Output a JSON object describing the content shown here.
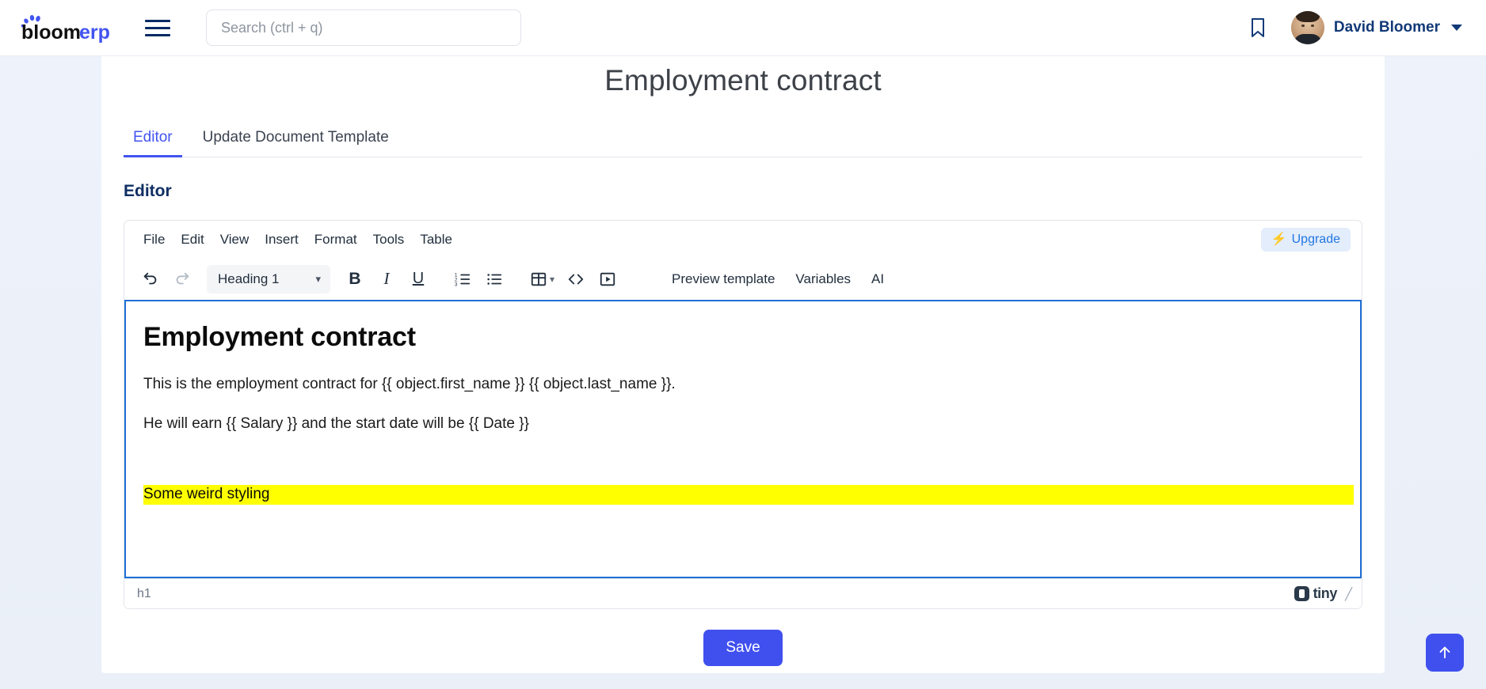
{
  "header": {
    "logo_text_primary": "bloom",
    "logo_text_accent": "erp",
    "menu_icon": "hamburger-icon",
    "search": {
      "placeholder": "Search (ctrl + q)",
      "value": ""
    },
    "bookmark_icon": "bookmark-icon",
    "user": {
      "name": "David Bloomer",
      "avatar": "user-avatar-photo",
      "caret_icon": "chevron-down-icon"
    },
    "colors": {
      "accent": "#4254f0",
      "navy": "#052a64"
    }
  },
  "page": {
    "title": "Employment contract",
    "tabs": [
      {
        "label": "Editor",
        "active": true
      },
      {
        "label": "Update Document Template",
        "active": false
      }
    ],
    "section_title": "Editor"
  },
  "editor": {
    "menubar": [
      "File",
      "Edit",
      "View",
      "Insert",
      "Format",
      "Tools",
      "Table"
    ],
    "upgrade": {
      "label": "Upgrade",
      "icon": "lightning-bolt-icon",
      "icon_color": "#ff6f1e",
      "text_color": "#2276e0"
    },
    "toolbar": {
      "undo_icon": "undo-arrow-icon",
      "redo_icon": "redo-arrow-icon",
      "format_select_value": "Heading 1",
      "bold_label": "B",
      "italic_label": "I",
      "underline_label": "U",
      "numbered_list_icon": "numbered-list-icon",
      "bullet_list_icon": "bullet-list-icon",
      "table_icon": "table-icon",
      "source_code_icon": "source-code-icon",
      "media_icon": "media-play-icon",
      "preview_template_label": "Preview template",
      "variables_label": "Variables",
      "ai_label": "AI"
    },
    "content": {
      "heading": "Employment contract",
      "paragraph_1": "This is the employment contract for {{ object.first_name }} {{ object.last_name }}.",
      "paragraph_2": "He will earn {{ Salary }} and the start date will be {{ Date }}",
      "highlighted_text": "Some weird styling",
      "highlight_color": "#ffff00"
    },
    "statusbar": {
      "element_path": "h1",
      "branding": "tiny",
      "branding_icon": "tiny-logo-icon",
      "resize_handle": "resize-grip-icon"
    },
    "focus_border_color": "#1f6fd4"
  },
  "footer": {
    "save_label": "Save",
    "save_color": "#4050ef",
    "scroll_top_icon": "arrow-up-icon"
  }
}
